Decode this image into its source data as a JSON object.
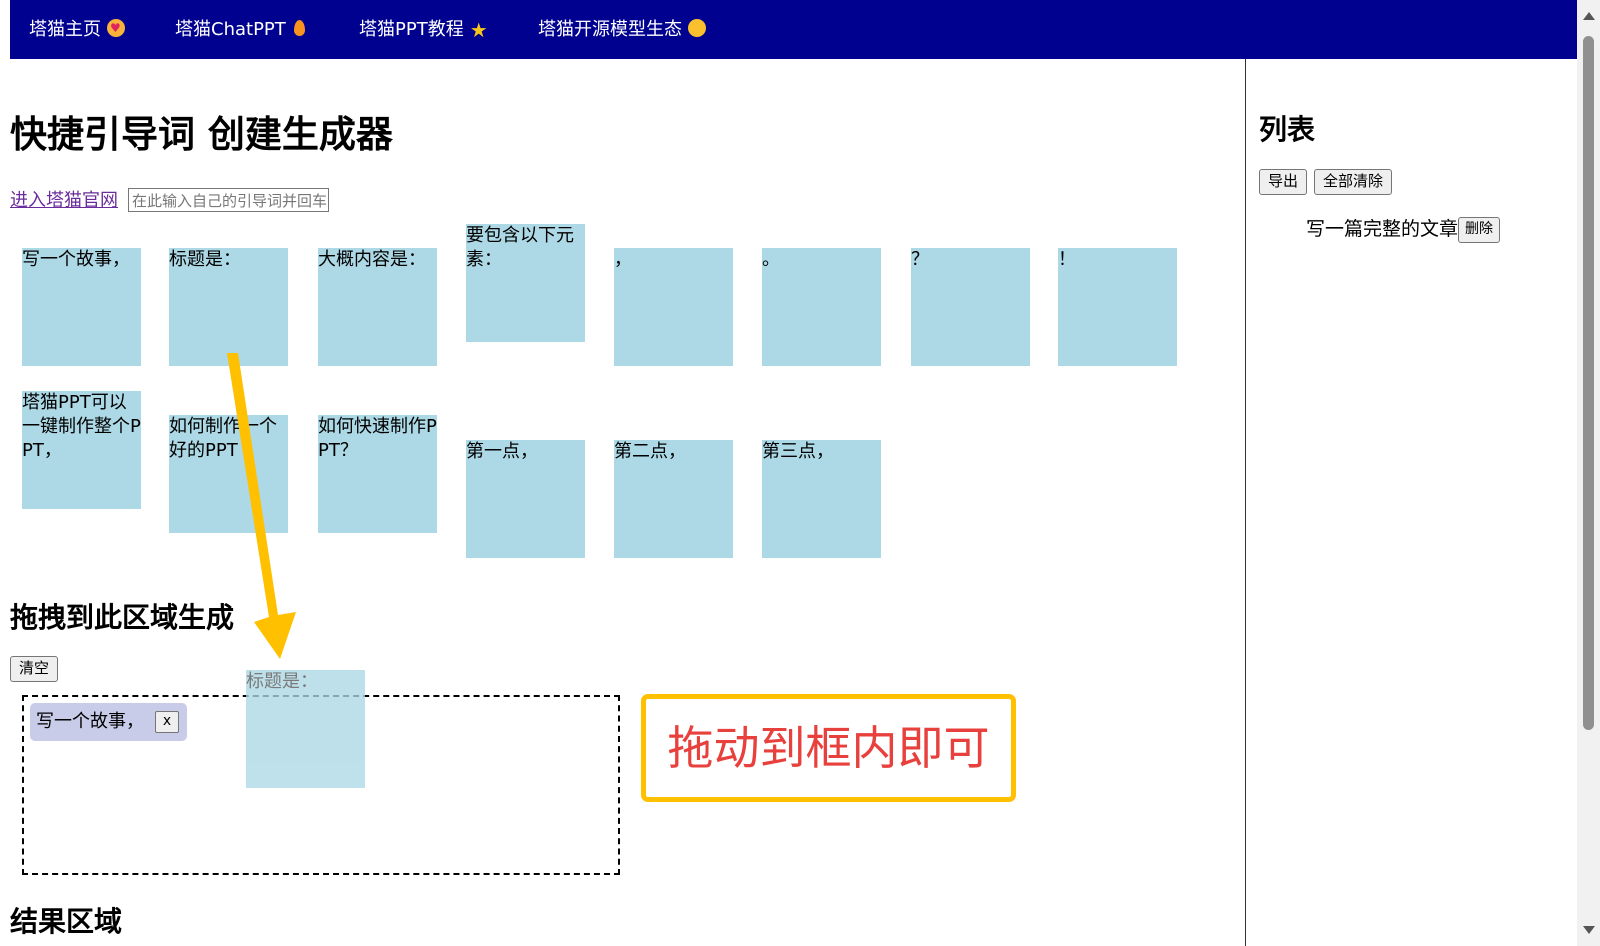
{
  "nav": {
    "items": [
      {
        "label": "塔猫主页",
        "icon": "smiling-face-with-hearts-icon"
      },
      {
        "label": "塔猫ChatPPT",
        "icon": "fire-icon"
      },
      {
        "label": "塔猫PPT教程",
        "icon": "star-icon"
      },
      {
        "label": "塔猫开源模型生态",
        "icon": "hugging-face-icon"
      }
    ],
    "background": "#010190"
  },
  "main": {
    "title": "快捷引导词 创建生成器",
    "site_link": "进入塔猫官网",
    "prompt_input_placeholder": "在此输入自己的引导词并回车",
    "cards_row1": [
      "写一个故事，",
      "标题是：",
      "大概内容是：",
      "要包含以下元素：",
      "，",
      "。",
      "？",
      "！"
    ],
    "cards_row2": [
      "塔猫PPT可以一键制作整个PPT，",
      "如何制作一个好的PPT",
      "如何快速制作PPT？",
      "第一点，",
      "第二点，",
      "第三点，"
    ],
    "card_color": "#add8e6",
    "drop_section_title": "拖拽到此区域生成",
    "clear_button": "清空",
    "dropped_chip": {
      "label": "写一个故事，",
      "remove_label": "x"
    },
    "dragging_card": "标题是：",
    "callout": "拖动到框内即可",
    "result_section_title": "结果区域"
  },
  "sidebar": {
    "title": "列表",
    "export_button": "导出",
    "clear_all_button": "全部清除",
    "items": [
      {
        "text": "写一篇完整的文章",
        "delete_label": "删除"
      }
    ]
  },
  "colors": {
    "callout_border": "#ffc000",
    "callout_text": "#e8403c",
    "arrow": "#ffc000",
    "chip": "#c8cce8"
  }
}
